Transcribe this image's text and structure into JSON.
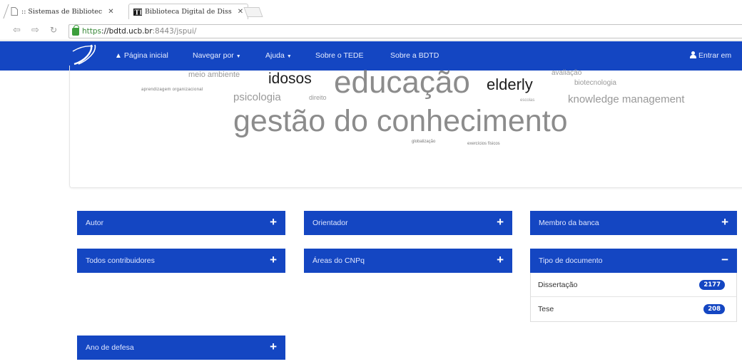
{
  "browser": {
    "tabs": [
      {
        "title": ":: Sistemas de Bibliotec",
        "icon": "page-icon"
      },
      {
        "title": "Biblioteca Digital de Diss",
        "icon": "bdtd-favicon-icon"
      }
    ],
    "url": {
      "scheme": "https",
      "host": "://bdtd.ucb.br",
      "path": ":8443/jspui/"
    }
  },
  "navbar": {
    "home": "Página inicial",
    "browse": "Navegar por",
    "help": "Ajuda",
    "about_tede": "Sobre o TEDE",
    "about_bdtd": "Sobre a BDTD",
    "login": "Entrar em"
  },
  "cloud": {
    "tags": [
      {
        "text": "meio ambiente",
        "weight": 1
      },
      {
        "text": "idosos",
        "weight": 4
      },
      {
        "text": "educação",
        "weight": 6
      },
      {
        "text": "elderly",
        "weight": 4
      },
      {
        "text": "avaliação",
        "weight": 1
      },
      {
        "text": "biotecnologia",
        "weight": 1
      },
      {
        "text": "aprendizagem organizacional",
        "weight": 0
      },
      {
        "text": "psicologia",
        "weight": 2
      },
      {
        "text": "direito",
        "weight": 1
      },
      {
        "text": "escolas",
        "weight": 0
      },
      {
        "text": "knowledge management",
        "weight": 2
      },
      {
        "text": "gestão do conhecimento",
        "weight": 6
      },
      {
        "text": "globalização",
        "weight": 0
      },
      {
        "text": "exercícios físicos",
        "weight": 0
      }
    ]
  },
  "facets": {
    "autor": "Autor",
    "orientador": "Orientador",
    "membro_banca": "Membro da banca",
    "contribuidores": "Todos contribuidores",
    "areas_cnpq": "Áreas do CNPq",
    "tipo_documento": "Tipo de documento",
    "ano_defesa": "Ano de defesa",
    "expand_symbol": "+",
    "collapse_symbol": "−",
    "tipo_items": [
      {
        "label": "Dissertação",
        "count": "2177"
      },
      {
        "label": "Tese",
        "count": "208"
      }
    ]
  }
}
